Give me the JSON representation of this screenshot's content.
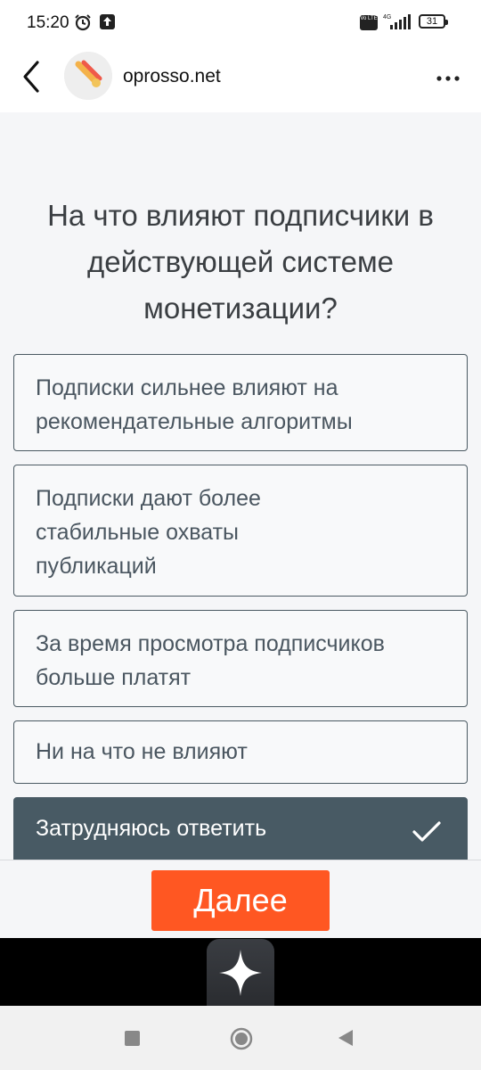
{
  "status_bar": {
    "time": "15:20",
    "network": "4G",
    "volte": "Vo LTE",
    "battery": "31",
    "icons": [
      "alarm-icon",
      "upload-icon",
      "volte-icon",
      "signal-icon",
      "battery-icon"
    ]
  },
  "header": {
    "site_name": "oprosso.net",
    "back_icon": "chevron-left-icon",
    "menu_icon": "more-dots-icon"
  },
  "survey": {
    "question": "На что влияют подписчики в действующей системе монетизации?",
    "options": [
      {
        "label": "Подписки сильнее влияют на рекомендательные алгоритмы",
        "selected": false
      },
      {
        "label": "Подписки дают более стабильные охваты публикаций",
        "selected": false
      },
      {
        "label": "За время просмотра подписчиков больше платят",
        "selected": false
      },
      {
        "label": "Ни на что не влияют",
        "selected": false
      },
      {
        "label": "Затрудняюсь ответить",
        "selected": true
      }
    ]
  },
  "footer": {
    "next_label": "Далее"
  },
  "colors": {
    "accent": "#ff5722",
    "selected_bg": "#485a64",
    "option_border": "#4a5962"
  }
}
